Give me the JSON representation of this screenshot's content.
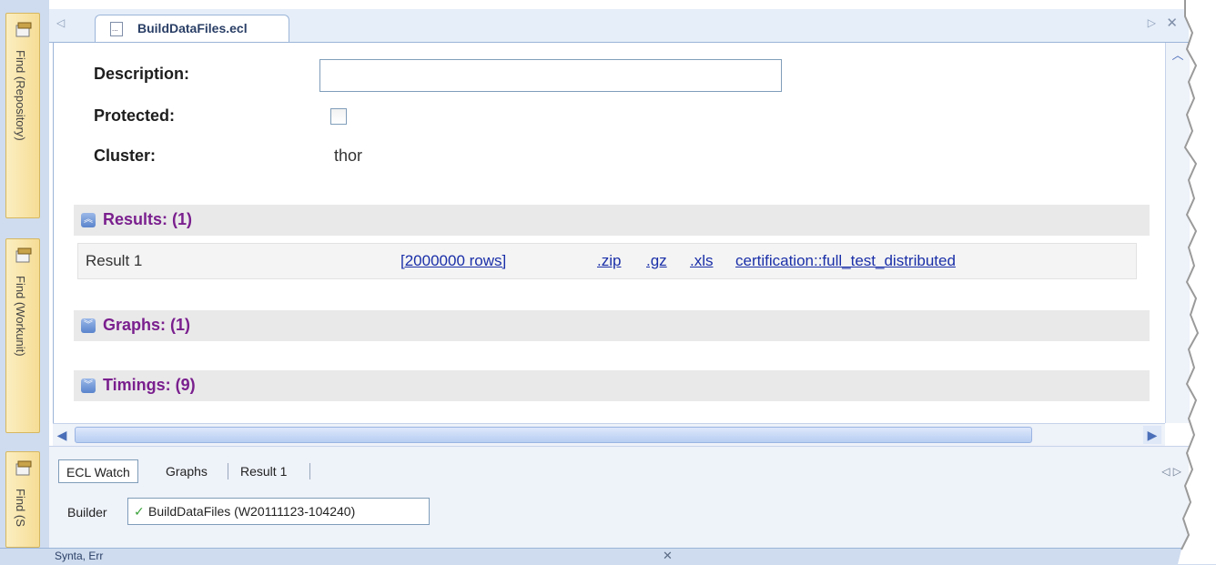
{
  "side_panels": [
    {
      "label": "Find (Repository)"
    },
    {
      "label": "Find (Workunit)"
    },
    {
      "label": "Find (S"
    }
  ],
  "tab": {
    "title": "BuildDataFiles.ecl"
  },
  "fields": {
    "description_label": "Description:",
    "description_value": "",
    "protected_label": "Protected:",
    "protected_checked": false,
    "cluster_label": "Cluster:",
    "cluster_value": "thor"
  },
  "sections": {
    "results": "Results: (1)",
    "graphs": "Graphs: (1)",
    "timings": "Timings: (9)"
  },
  "results": [
    {
      "name": "Result 1",
      "rows": "[2000000 rows]",
      "zip": ".zip",
      "gz": ".gz",
      "xls": ".xls",
      "file": "certification::full_test_distributed"
    }
  ],
  "bottom_tabs": [
    "ECL Watch",
    "Graphs",
    "Result 1"
  ],
  "builder": {
    "label": "Builder",
    "item": "BuildDataFiles (W20111123-104240)"
  },
  "bottom_dock": {
    "label": "Synta, Err"
  },
  "colors": {
    "section_title": "#7a1f8e",
    "link": "#1a2fa8",
    "tab_strip": "#e6eef9"
  }
}
